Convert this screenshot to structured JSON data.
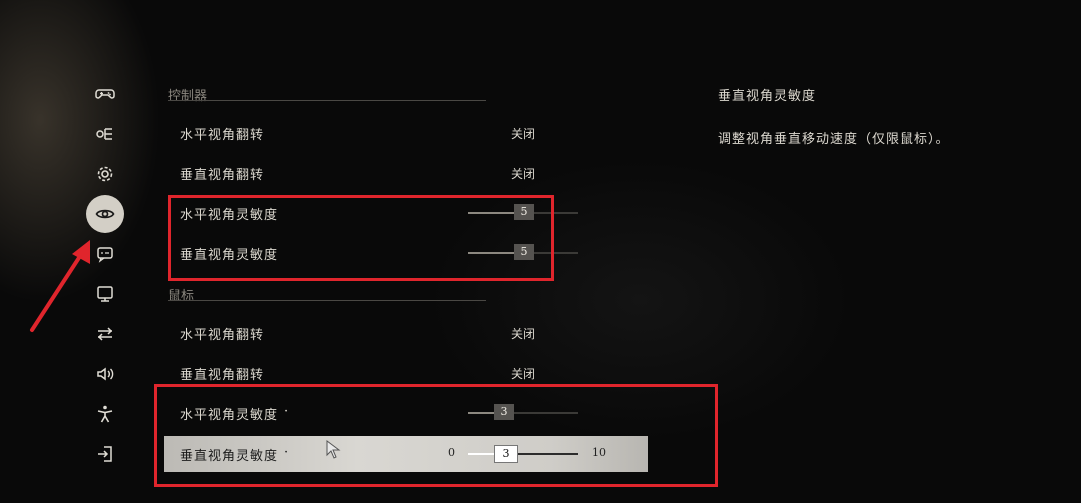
{
  "sidebar": {
    "items": [
      {
        "icon": "gamepad-icon"
      },
      {
        "icon": "controls-toggle-icon"
      },
      {
        "icon": "gear-icon"
      },
      {
        "icon": "eye-icon",
        "active": true
      },
      {
        "icon": "subtitle-icon"
      },
      {
        "icon": "monitor-icon"
      },
      {
        "icon": "adjust-icon"
      },
      {
        "icon": "speaker-icon"
      },
      {
        "icon": "accessibility-icon"
      },
      {
        "icon": "exit-icon"
      }
    ]
  },
  "sections": {
    "controller": {
      "title": "控制器",
      "rows": [
        {
          "label": "水平视角翻转",
          "value": "关闭"
        },
        {
          "label": "垂直视角翻转",
          "value": "关闭"
        },
        {
          "label": "水平视角灵敏度",
          "value": "5"
        },
        {
          "label": "垂直视角灵敏度",
          "value": "5"
        }
      ]
    },
    "mouse": {
      "title": "鼠标",
      "rows": [
        {
          "label": "水平视角翻转",
          "value": "关闭"
        },
        {
          "label": "垂直视角翻转",
          "value": "关闭"
        },
        {
          "label": "水平视角灵敏度",
          "marker": "·",
          "value": "3"
        },
        {
          "label": "垂直视角灵敏度",
          "marker": "·",
          "value": "3",
          "min": "0",
          "max": "10"
        }
      ]
    }
  },
  "description": {
    "title": "垂直视角灵敏度",
    "text": "调整视角垂直移动速度（仅限鼠标）。"
  },
  "colors": {
    "annotation": "#e0252c",
    "selected_row": "#d3d1cc"
  }
}
